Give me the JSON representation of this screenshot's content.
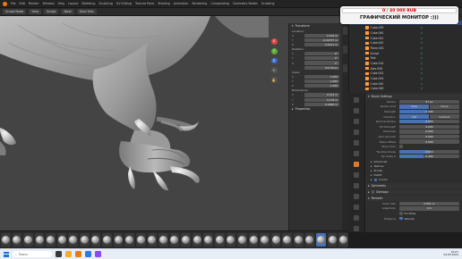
{
  "menubar": {
    "items": [
      "File",
      "Edit",
      "Render",
      "Window",
      "Help",
      "Layout",
      "Modeling",
      "Sculpting",
      "UV Editing",
      "Texture Paint",
      "Shading",
      "Animation",
      "Rendering",
      "Compositing",
      "Geometry Nodes",
      "Scripting"
    ]
  },
  "header": {
    "mode": "Sculpt Mode",
    "view": "View",
    "sculpt": "Sculpt",
    "mask": "Mask",
    "face_sets": "Face Sets"
  },
  "donation": {
    "progress_text": "0 / 40 000 RUB",
    "progress_fraction": 0.0,
    "goal_text": "ГРАФИЧЕСКИЙ МОНИТОР :)))"
  },
  "npanel": {
    "transform_title": "Transform",
    "location_title": "Location:",
    "location": [
      {
        "axis": "X",
        "value": "0.104 m"
      },
      {
        "axis": "Y",
        "value": "-0.00757 m"
      },
      {
        "axis": "Z",
        "value": "0.0411 m"
      }
    ],
    "rotation_title": "Rotation:",
    "rotation": [
      {
        "axis": "X",
        "value": "0°"
      },
      {
        "axis": "Y",
        "value": "0°"
      },
      {
        "axis": "Z",
        "value": "0°"
      }
    ],
    "mode": "XYZ Euler",
    "scale_title": "Scale:",
    "scale": [
      {
        "axis": "X",
        "value": "1.000"
      },
      {
        "axis": "Y",
        "value": "1.000"
      },
      {
        "axis": "Z",
        "value": "1.000"
      }
    ],
    "dimensions_title": "Dimensions:",
    "dimensions": [
      {
        "axis": "X",
        "value": "0.213 m"
      },
      {
        "axis": "Y",
        "value": "0.178 m"
      },
      {
        "axis": "Z",
        "value": "0.0892 m"
      }
    ],
    "properties_title": "Properties"
  },
  "outliner": {
    "header": "Options",
    "rows": [
      {
        "label": "Cube.037",
        "sel": false
      },
      {
        "label": "Cube.038",
        "sel": true
      },
      {
        "label": "Cube.039",
        "sel": false
      },
      {
        "label": "Cube.040",
        "sel": false
      },
      {
        "label": "Cube.041",
        "sel": false
      },
      {
        "label": "Cube.042",
        "sel": false
      },
      {
        "label": "Plane.001",
        "sel": false
      },
      {
        "label": "Sculpt",
        "sel": false
      },
      {
        "label": "Text",
        "sel": false
      },
      {
        "label": "Cube.024",
        "sel": false
      },
      {
        "label": "Alex.006",
        "sel": false
      },
      {
        "label": "Cube.043",
        "sel": false
      },
      {
        "label": "Cube.044",
        "sel": false
      },
      {
        "label": "Cube.045",
        "sel": false
      },
      {
        "label": "Cube.046",
        "sel": false
      }
    ]
  },
  "properties": {
    "brush_settings": "Brush Settings",
    "radius_label": "Radius",
    "radius_value": "97 px",
    "radius_unit_label": "Radius Unit",
    "radius_unit_options": [
      "View",
      "Scene"
    ],
    "strength_label": "Strength",
    "strength_value": "0.449",
    "strength_fraction": 0.45,
    "direction_label": "Direction",
    "direction_options": [
      "Add",
      "Subtract"
    ],
    "normal_radius_label": "Normal Radius",
    "normal_radius_value": "0.500",
    "normal_radius_fraction": 0.5,
    "tilt_strength_label": "Tilt Strength",
    "tilt_strength_value": "0.000",
    "hardness_label": "Hardness",
    "hardness_value": "0.000",
    "autosmooth_label": "Auto-Smooth",
    "autosmooth_value": "0.000",
    "plane_offset_label": "Plane Offset",
    "plane_offset_value": "0.000",
    "plane_trim_label": "Plane Trim",
    "tip_roundness_label": "Tip Roundness",
    "tip_roundness_value": "0.514",
    "tip_roundness_fraction": 0.51,
    "tip_scale_label": "Tip Scale X",
    "tip_scale_value": "0.400",
    "tip_scale_fraction": 0.4,
    "advanced": "Advanced",
    "texture": "Texture",
    "stroke": "Stroke",
    "falloff": "Falloff",
    "cursor": "Cursor",
    "symmetry": "Symmetry",
    "dyntopo": "Dyntopo",
    "remesh": "Remesh",
    "voxel_size_label": "Voxel Size",
    "voxel_size_value": "0.001 m",
    "adaptivity_label": "Adaptivity",
    "adaptivity_value": "0 m",
    "fix_poles": "Fix Poles",
    "preserve_label": "Preserve",
    "volume": "Volume"
  },
  "taskbar": {
    "search_placeholder": "Поиск",
    "time": "16:07",
    "date": "04.05.2024",
    "lang": "РУС"
  },
  "colors": {
    "accent_blue": "#4772b3",
    "selected_row": "#334d80",
    "object_orange": "#ff9a3d",
    "gizmo_red": "#e04646",
    "gizmo_green": "#5aad3a",
    "gizmo_blue": "#3a6ecf"
  },
  "toolbar": {
    "brush_count": 31,
    "selected_index": 28
  }
}
